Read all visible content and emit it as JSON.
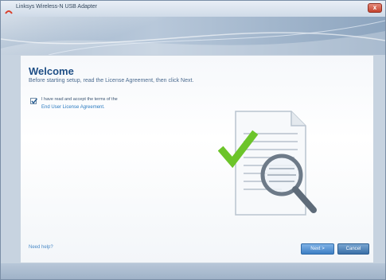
{
  "window": {
    "title": "Linksys Wireless-N USB Adapter",
    "close_label": "x"
  },
  "content": {
    "heading": "Welcome",
    "subtitle": "Before starting setup, read the License Agreement, then click Next.",
    "checkbox_label": "I have read and accept the terms of the",
    "checkbox_checked": true,
    "eula_link": "End User License Agreement.",
    "help_link": "Need help?"
  },
  "buttons": {
    "next": "Next >",
    "cancel": "Cancel"
  },
  "icons": {
    "title": "linksys-logo-icon",
    "illustration": "license-document-magnifier-icon",
    "check": "green-checkmark-icon"
  },
  "colors": {
    "accent": "#3d7fc4",
    "heading": "#1f4f86",
    "link": "#2a7ac0",
    "checkmark": "#6cc42a"
  }
}
